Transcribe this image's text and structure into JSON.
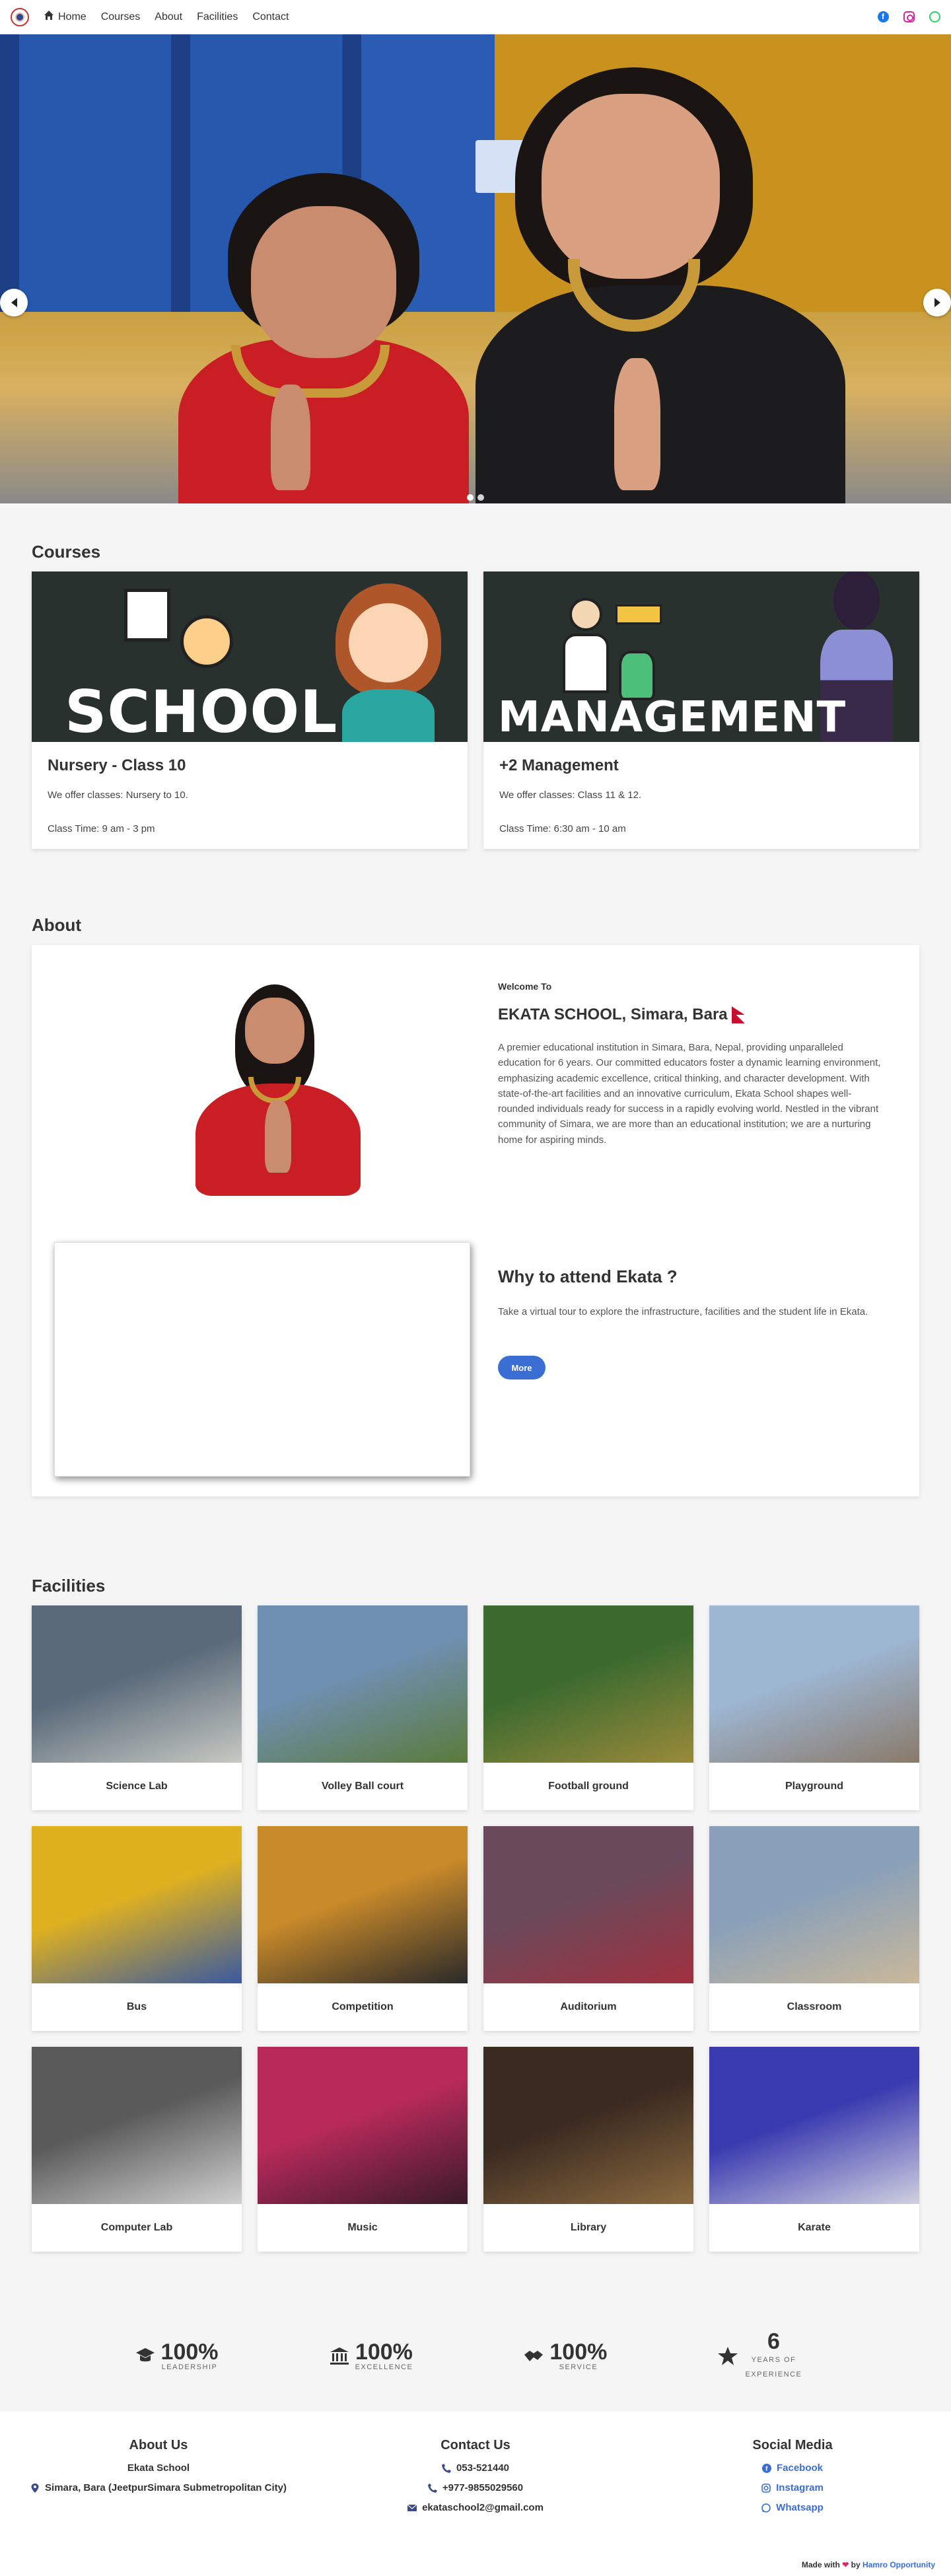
{
  "nav": {
    "links": [
      "Home",
      "Courses",
      "About",
      "Facilities",
      "Contact"
    ]
  },
  "hero": {
    "slides": 2,
    "active_slide": 1
  },
  "courses": {
    "title": "Courses",
    "items": [
      {
        "banner": "SCHOOL",
        "name": "Nursery - Class 10",
        "offer": "We offer classes: Nursery to 10.",
        "time": "Class Time: 9 am - 3 pm"
      },
      {
        "banner": "MANAGEMENT",
        "name": "+2 Management",
        "offer": "We offer classes: Class 11 & 12.",
        "time": "Class Time: 6:30 am - 10 am"
      }
    ]
  },
  "about": {
    "title": "About",
    "welcome": "Welcome To",
    "school_name": "EKATA SCHOOL, Simara, Bara",
    "description": "A premier educational institution in Simara, Bara, Nepal, providing unparalleled education for 6 years. Our committed educators foster a dynamic learning environment, emphasizing academic excellence, critical thinking, and character development. With state-of-the-art facilities and an innovative curriculum, Ekata School shapes well-rounded individuals ready for success in a rapidly evolving world. Nestled in the vibrant community of Simara, we are more than an educational institution; we are a nurturing home for aspiring minds.",
    "why_title": "Why to attend Ekata ?",
    "why_text": "Take a virtual tour to explore the infrastructure, facilities and the student life in Ekata.",
    "more_label": "More"
  },
  "facilities": {
    "title": "Facilities",
    "items": [
      {
        "label": "Science Lab",
        "c1": "#5a6a7a",
        "c2": "#c7c9c2"
      },
      {
        "label": "Volley Ball court",
        "c1": "#6f8fb0",
        "c2": "#5a7a3a"
      },
      {
        "label": "Football ground",
        "c1": "#3d6b2f",
        "c2": "#9a8a3a"
      },
      {
        "label": "Playground",
        "c1": "#9db6d2",
        "c2": "#8a7a6a"
      },
      {
        "label": "Bus",
        "c1": "#e0b11f",
        "c2": "#3a5aa0"
      },
      {
        "label": "Competition",
        "c1": "#c98a2a",
        "c2": "#2a2a2a"
      },
      {
        "label": "Auditorium",
        "c1": "#6a4a5a",
        "c2": "#a03040"
      },
      {
        "label": "Classroom",
        "c1": "#8aa0b8",
        "c2": "#c9b89a"
      },
      {
        "label": "Computer Lab",
        "c1": "#5a5a5a",
        "c2": "#d0d0d0"
      },
      {
        "label": "Music",
        "c1": "#b82a5a",
        "c2": "#3a1a2a"
      },
      {
        "label": "Library",
        "c1": "#3a2a20",
        "c2": "#8a6a40"
      },
      {
        "label": "Karate",
        "c1": "#3a3ab0",
        "c2": "#d0d0e0"
      }
    ]
  },
  "stats": [
    {
      "num": "100%",
      "label": "LEADERSHIP",
      "icon": "graduate-icon"
    },
    {
      "num": "100%",
      "label": "EXCELLENCE",
      "icon": "institution-icon"
    },
    {
      "num": "100%",
      "label": "SERVICE",
      "icon": "handshake-icon"
    },
    {
      "num": "6",
      "label": "YEARS OF EXPERIENCE",
      "icon": "star-icon"
    }
  ],
  "footer": {
    "about_head": "About Us",
    "school": "Ekata School",
    "address": "Simara, Bara (JeetpurSimara Submetropolitan City)",
    "contact_head": "Contact Us",
    "phone1": "053-521440",
    "phone2": "+977-9855029560",
    "email": "ekataschool2@gmail.com",
    "social_head": "Social Media",
    "facebook": "Facebook",
    "instagram": "Instagram",
    "whatsapp": "Whatsapp",
    "made_prefix": "Made with",
    "made_by": "by",
    "made_link": "Hamro Opportunity"
  }
}
